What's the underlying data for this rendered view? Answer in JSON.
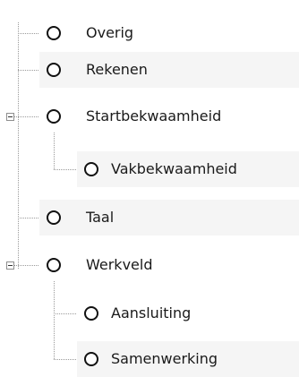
{
  "tree": {
    "nodes": [
      {
        "label": "Overig",
        "selected": false,
        "expanded": null
      },
      {
        "label": "Rekenen",
        "selected": false,
        "expanded": null
      },
      {
        "label": "Startbekwaamheid",
        "selected": false,
        "expanded": true
      },
      {
        "label": "Vakbekwaamheid",
        "selected": false,
        "expanded": null
      },
      {
        "label": "Taal",
        "selected": false,
        "expanded": null
      },
      {
        "label": "Werkveld",
        "selected": false,
        "expanded": true
      },
      {
        "label": "Aansluiting",
        "selected": false,
        "expanded": null
      },
      {
        "label": "Samenwerking",
        "selected": false,
        "expanded": null
      }
    ],
    "colors": {
      "row_alt_background": "#f5f5f5",
      "guide_line": "#9a9a9a",
      "radio_border": "#111111",
      "text": "#1a1a1a"
    }
  }
}
